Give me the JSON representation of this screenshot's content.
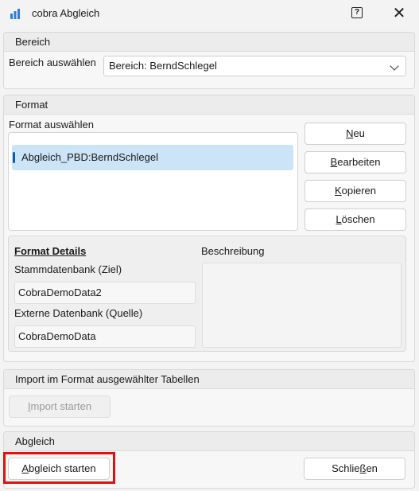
{
  "window": {
    "title": "cobra Abgleich",
    "icons": {
      "app": "chart-bars-icon",
      "help": "help-icon",
      "close": "close-icon"
    },
    "help_glyph": "?",
    "close_glyph": "✕"
  },
  "bereich": {
    "header": "Bereich",
    "label": "Bereich auswählen",
    "selected": "Bereich: BerndSchlegel"
  },
  "format": {
    "header": "Format",
    "label": "Format auswählen",
    "items": [
      "Abgleich_PBD:BerndSchlegel"
    ],
    "buttons": {
      "neu": {
        "ul": "N",
        "rest": "eu"
      },
      "bearbeiten": {
        "ul": "B",
        "rest": "earbeiten"
      },
      "kopieren": {
        "ul": "K",
        "rest": "opieren"
      },
      "loeschen": {
        "ul": "L",
        "rest": "öschen"
      }
    },
    "details": {
      "title": "Format Details",
      "beschreibung_label": "Beschreibung",
      "stamm_label": "Stammdatenbank (Ziel)",
      "stamm_value": "CobraDemoData2",
      "extern_label": "Externe Datenbank (Quelle)",
      "extern_value": "CobraDemoData"
    }
  },
  "import": {
    "header": "Import im Format ausgewählter Tabellen",
    "button": {
      "ul": "I",
      "rest": "mport starten"
    }
  },
  "abgleich": {
    "header": "Abgleich",
    "start": {
      "ul": "A",
      "rest": "bgleich starten"
    },
    "close": {
      "pre": "Schlie",
      "ul": "ß",
      "rest": "en"
    }
  },
  "colors": {
    "accent": "#005fb8",
    "selection": "#cce4f7",
    "highlight": "#e01010"
  }
}
